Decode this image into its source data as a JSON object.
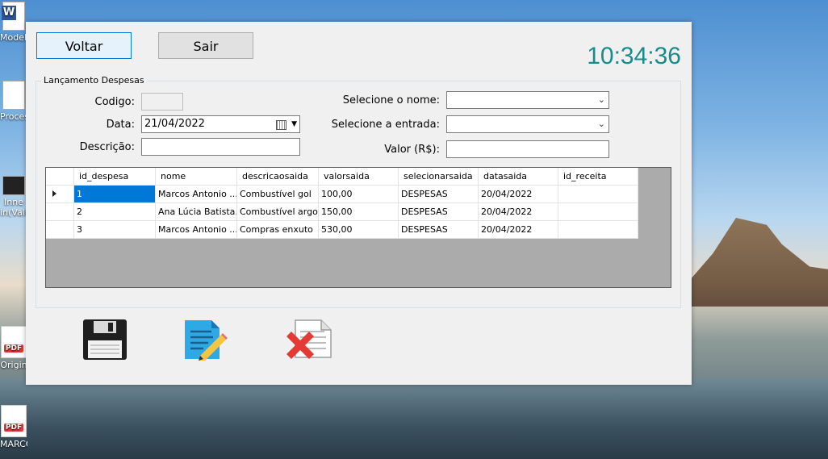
{
  "desktop": {
    "icons": [
      {
        "label": "Modelo",
        "type": "word"
      },
      {
        "label": "Process",
        "type": "doc"
      },
      {
        "label": "Inne\nin(Vali",
        "type": "doc"
      },
      {
        "label": "Origin",
        "type": "pdf"
      },
      {
        "label": "MARCO-A...",
        "type": "pdf"
      }
    ]
  },
  "window": {
    "buttons": {
      "back": "Voltar",
      "exit": "Sair"
    },
    "clock": "10:34:36",
    "group_title": "Lançamento Despesas",
    "form": {
      "codigo_label": "Codigo:",
      "codigo_value": "",
      "data_label": "Data:",
      "data_value": "21/04/2022",
      "descricao_label": "Descrição:",
      "descricao_value": "",
      "nome_label": "Selecione o nome:",
      "nome_value": "",
      "entrada_label": "Selecione a entrada:",
      "entrada_value": "",
      "valor_label": "Valor (R$):",
      "valor_value": ""
    },
    "grid": {
      "columns": [
        "id_despesa",
        "nome",
        "descricaosaida",
        "valorsaida",
        "selecionarsaida",
        "datasaida",
        "id_receita"
      ],
      "rows": [
        [
          "1",
          "Marcos Antonio ...",
          "Combustível gol",
          "100,00",
          "DESPESAS",
          "20/04/2022",
          ""
        ],
        [
          "2",
          "Ana Lúcia Batista...",
          "Combustível argo",
          "150,00",
          "DESPESAS",
          "20/04/2022",
          ""
        ],
        [
          "3",
          "Marcos Antonio ...",
          "Compras enxuto",
          "530,00",
          "DESPESAS",
          "20/04/2022",
          ""
        ]
      ]
    },
    "actions": {
      "save": "save-icon",
      "edit": "edit-icon",
      "delete": "delete-icon"
    }
  }
}
